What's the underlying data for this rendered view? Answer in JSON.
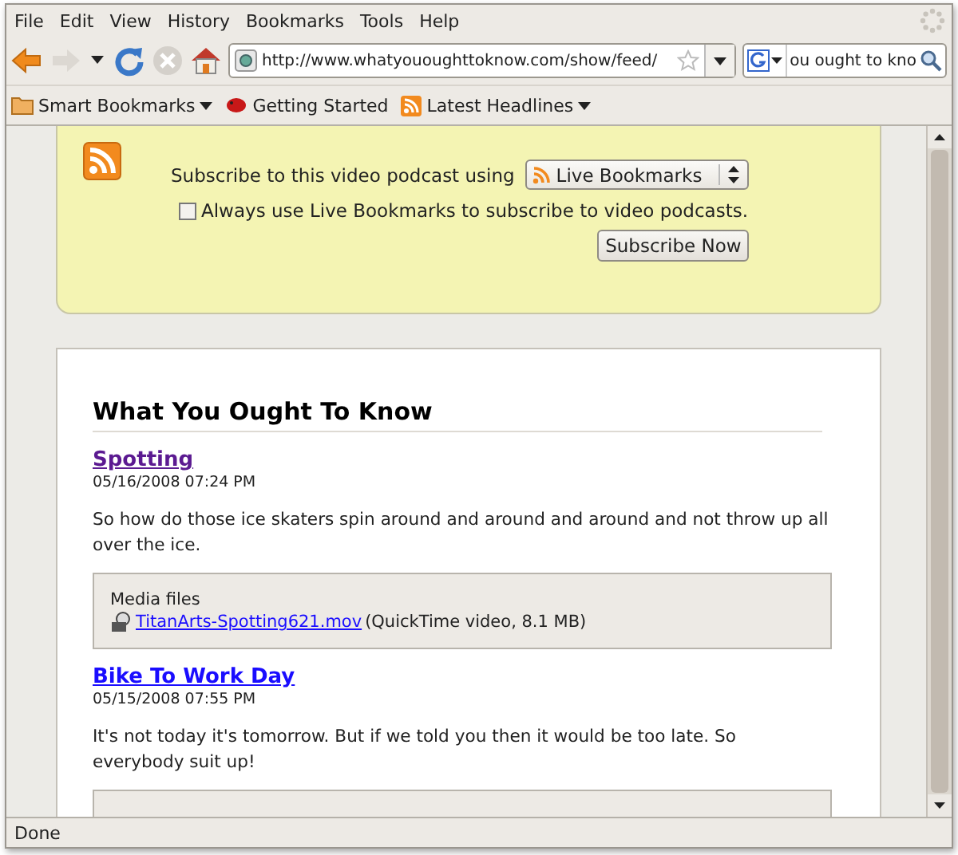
{
  "menu": [
    "File",
    "Edit",
    "View",
    "History",
    "Bookmarks",
    "Tools",
    "Help"
  ],
  "navigation": {
    "url": "http://www.whatyououghttoknow.com/show/feed/",
    "search_value": "ou ought to kno"
  },
  "bookmarks": [
    {
      "label": "Smart Bookmarks",
      "kind": "folder",
      "dropdown": true
    },
    {
      "label": "Getting Started",
      "kind": "page",
      "dropdown": false
    },
    {
      "label": "Latest Headlines",
      "kind": "feed",
      "dropdown": true
    }
  ],
  "subscribe": {
    "prompt": "Subscribe to this video podcast using",
    "reader": "Live Bookmarks",
    "always_label": "Always use Live Bookmarks to subscribe to video podcasts.",
    "always_checked": false,
    "button": "Subscribe Now"
  },
  "feed": {
    "title": "What You Ought To Know",
    "entries": [
      {
        "title": "Spotting",
        "visited": true,
        "date": "05/16/2008 07:24 PM",
        "summary": "So how do those ice skaters spin around and around and around and not throw up all over the ice.",
        "media_heading": "Media files",
        "file": "TitanArts-Spotting621.mov",
        "file_info": "(QuickTime video, 8.1 MB)"
      },
      {
        "title": "Bike To Work Day",
        "visited": false,
        "date": "05/15/2008 07:55 PM",
        "summary": "It's not today it's tomorrow. But if we told you then it would be too late. So everybody suit up!"
      }
    ]
  },
  "status_bar": {
    "text": "Done"
  }
}
